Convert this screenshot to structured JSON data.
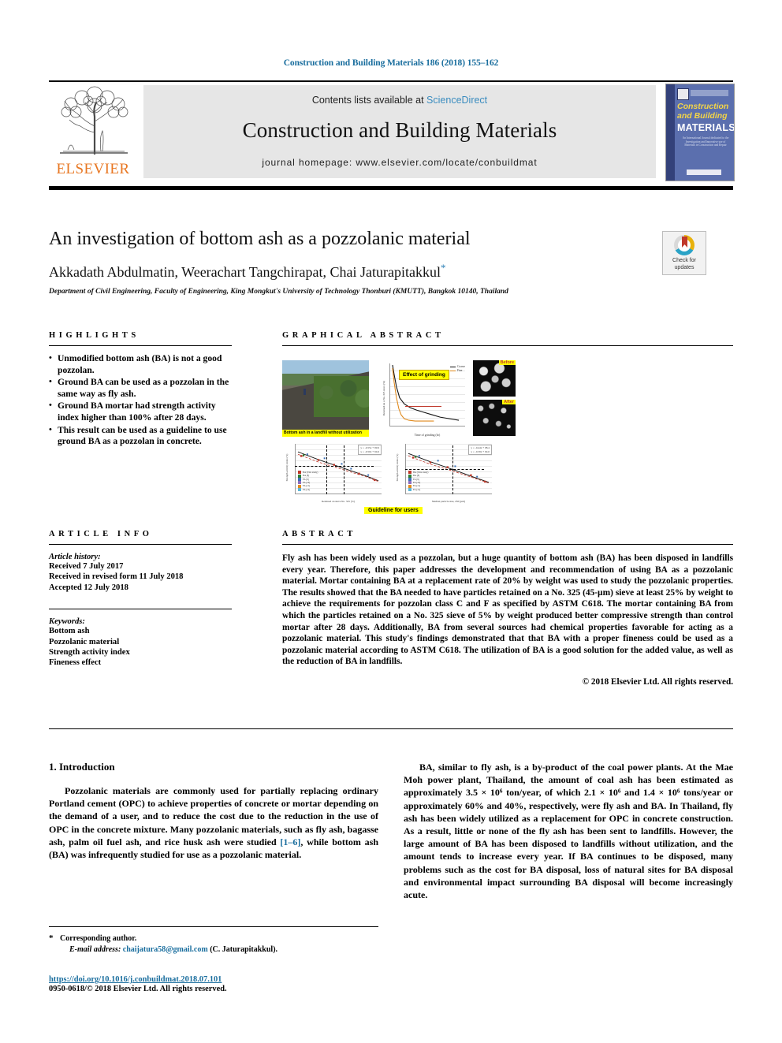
{
  "running_head": "Construction and Building Materials 186 (2018) 155–162",
  "masthead": {
    "publisher_name": "ELSEVIER",
    "contents_prefix": "Contents lists available at",
    "sciencedirect": "ScienceDirect",
    "journal_title": "Construction and Building Materials",
    "homepage": "journal homepage: www.elsevier.com/locate/conbuildmat",
    "cover": {
      "line1": "Construction",
      "line2": "and Building",
      "line3": "MATERIALS",
      "blurb": "An International Journal dedicated to the Investigation and Innovative use of Materials in Construction and Repair"
    }
  },
  "article": {
    "title": "An investigation of bottom ash as a pozzolanic material",
    "authors": "Akkadath Abdulmatin, Weerachart Tangchirapat, Chai Jaturapitakkul",
    "corresponding_mark": "*",
    "affiliation": "Department of Civil Engineering, Faculty of Engineering, King Mongkut's University of Technology Thonburi (KMUTT), Bangkok 10140, Thailand"
  },
  "crossmark": {
    "line1": "Check for",
    "line2": "updates"
  },
  "highlights": {
    "heading": "HIGHLIGHTS",
    "items": [
      "Unmodified bottom ash (BA) is not a good pozzolan.",
      "Ground BA can be used as a pozzolan in the same way as fly ash.",
      "Ground BA mortar had strength activity index higher than 100% after 28 days.",
      "This result can be used as a guideline to use ground BA as a pozzolan in concrete."
    ]
  },
  "graphical_abstract": {
    "heading": "GRAPHICAL ABSTRACT",
    "photo_caption": "Bottom ash in a landfill without utilization",
    "grinding_badge": "Effect of grinding",
    "grinding_legend": [
      "Coarse",
      "Fine"
    ],
    "grinding_xlabel": "Time of grinding (hr)",
    "grinding_ylabel": "Retained on a No. 325 sieve (%)",
    "sem_before": "Before",
    "sem_after": "After",
    "chart2_xlabel": "Retained on sieve No. 325 (%)",
    "chart2_ylabel": "Strength activity index (%)",
    "chart3_xlabel": "Median particle size, d50 (µm)",
    "chart3_ylabel": "Strength activity index (%)",
    "guideline_badge": "Guideline for users"
  },
  "article_info": {
    "heading": "ARTICLE INFO",
    "history_label": "Article history:",
    "history": [
      "Received 7 July 2017",
      "Received in revised form 11 July 2018",
      "Accepted 12 July 2018"
    ],
    "keywords_label": "Keywords:",
    "keywords": [
      "Bottom ash",
      "Pozzolanic material",
      "Strength activity index",
      "Fineness effect"
    ]
  },
  "abstract": {
    "heading": "ABSTRACT",
    "text": "Fly ash has been widely used as a pozzolan, but a huge quantity of bottom ash (BA) has been disposed in landfills every year. Therefore, this paper addresses the development and recommendation of using BA as a pozzolanic material. Mortar containing BA at a replacement rate of 20% by weight was used to study the pozzolanic properties. The results showed that the BA needed to have particles retained on a No. 325 (45-µm) sieve at least 25% by weight to achieve the requirements for pozzolan class C and F as specified by ASTM C618. The mortar containing BA from which the particles retained on a No. 325 sieve of 5% by weight produced better compressive strength than control mortar after 28 days. Additionally, BA from several sources had chemical properties favorable for acting as a pozzolanic material. This study's findings demonstrated that that BA with a proper fineness could be used as a pozzolanic material according to ASTM C618. The utilization of BA is a good solution for the added value, as well as the reduction of BA in landfills.",
    "copyright": "© 2018 Elsevier Ltd. All rights reserved."
  },
  "body": {
    "section_title": "1. Introduction",
    "left_paragraph_1a": "Pozzolanic materials are commonly used for partially replacing ordinary Portland cement (OPC) to achieve properties of concrete or mortar depending on the demand of a user, and to reduce the cost due to the reduction in the use of OPC in the concrete mixture. Many pozzolanic materials, such as fly ash, bagasse ash, palm oil fuel ash, and rice husk ash were studied ",
    "left_ref": "[1–6]",
    "left_paragraph_1b": ", while bottom ash (BA) was infrequently studied for use as a pozzolanic material.",
    "right_paragraph_1": "BA, similar to fly ash, is a by-product of the coal power plants. At the Mae Moh power plant, Thailand, the amount of coal ash has been estimated as approximately 3.5 × 10⁶ ton/year, of which 2.1 × 10⁶ and 1.4 × 10⁶ tons/year or approximately 60% and 40%, respectively, were fly ash and BA. In Thailand, fly ash has been widely utilized as a replacement for OPC in concrete construction. As a result, little or none of the fly ash has been sent to landfills. However, the large amount of BA has been disposed to landfills without utilization, and the amount tends to increase every year. If BA continues to be disposed, many problems such as the cost for BA disposal, loss of natural sites for BA disposal and environmental impact surrounding BA disposal will become increasingly acute."
  },
  "footer": {
    "corresponding_star": "*",
    "corresponding_label": "Corresponding author.",
    "email_label": "E-mail address:",
    "email": "chaijatura58@gmail.com",
    "email_suffix": "(C. Jaturapitakkul).",
    "doi": "https://doi.org/10.1016/j.conbuildmat.2018.07.101",
    "issn": "0950-0618/© 2018 Elsevier Ltd. All rights reserved."
  },
  "colors": {
    "link": "#1a6e9e",
    "sciencedirect": "#3a8cbf",
    "elsevier_orange": "#e87722",
    "masthead_bg": "#e6e6e6",
    "highlight_yellow": "#ffff00"
  }
}
